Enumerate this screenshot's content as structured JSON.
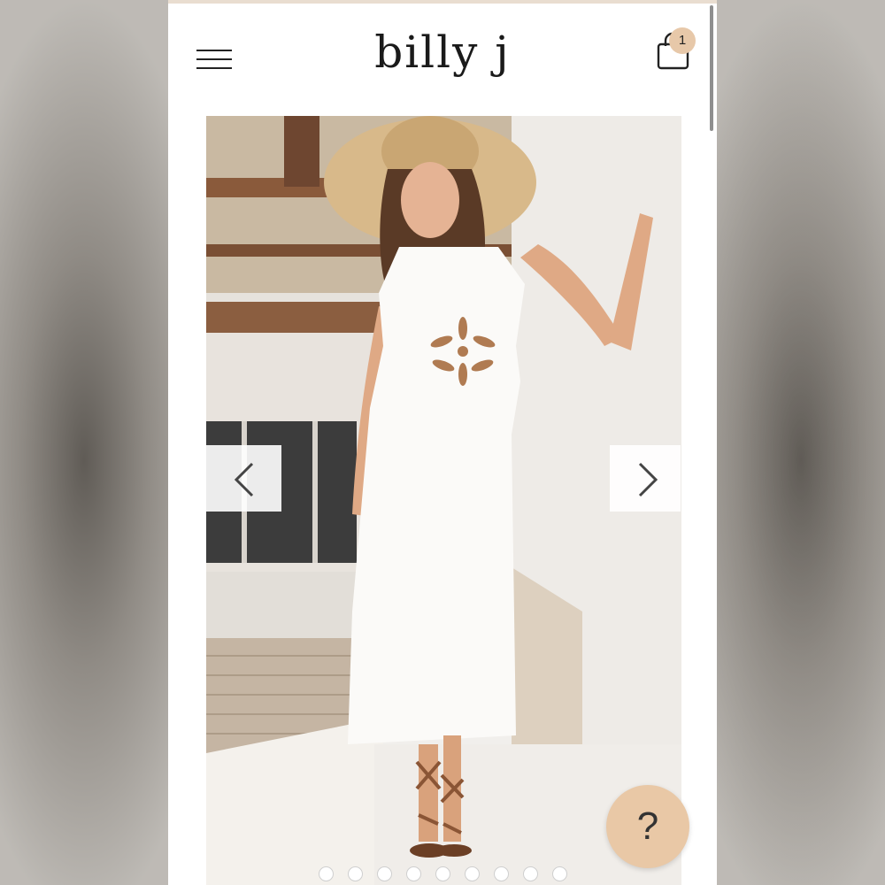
{
  "header": {
    "brand": "billy j",
    "cart_count": "1",
    "menu_icon": "hamburger-menu-icon",
    "cart_icon": "shopping-bag-icon"
  },
  "gallery": {
    "image_subject": "model in white cut-out midi dress with straw hat",
    "prev_icon": "chevron-left-icon",
    "next_icon": "chevron-right-icon",
    "slide_count": 9
  },
  "help": {
    "label": "?"
  },
  "colors": {
    "accent": "#e9c8a6",
    "badge": "#e7c8a9",
    "text": "#1a1a1a"
  }
}
